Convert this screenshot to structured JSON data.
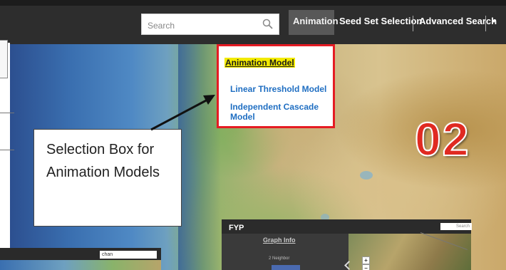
{
  "header": {
    "search": {
      "placeholder": "Search",
      "value": "",
      "icon": "search-icon"
    },
    "nav": {
      "animation": "Animation",
      "seed_set_selection": "Seed Set Selection",
      "advanced_search": "Advanced Search",
      "separator": "|"
    }
  },
  "dropdown": {
    "title": "Animation Model",
    "items": [
      "Linear Threshold Model",
      "Independent Cascade Model"
    ],
    "border_color": "#e51b23",
    "highlight_color": "#f2ea00"
  },
  "annotation": {
    "text": "Selection Box for Animation Models"
  },
  "step_number": "02",
  "insets": {
    "left": {
      "search_value": "chan"
    },
    "right": {
      "title": "FYP",
      "search_placeholder": "Search",
      "graph_info": "Graph Info",
      "neighbor": "2 Neighbor"
    }
  },
  "colors": {
    "topbar": "#2d2d2d",
    "active_nav": "#585858",
    "menu_link": "#1f6ec2",
    "step_number": "#e02a22"
  }
}
